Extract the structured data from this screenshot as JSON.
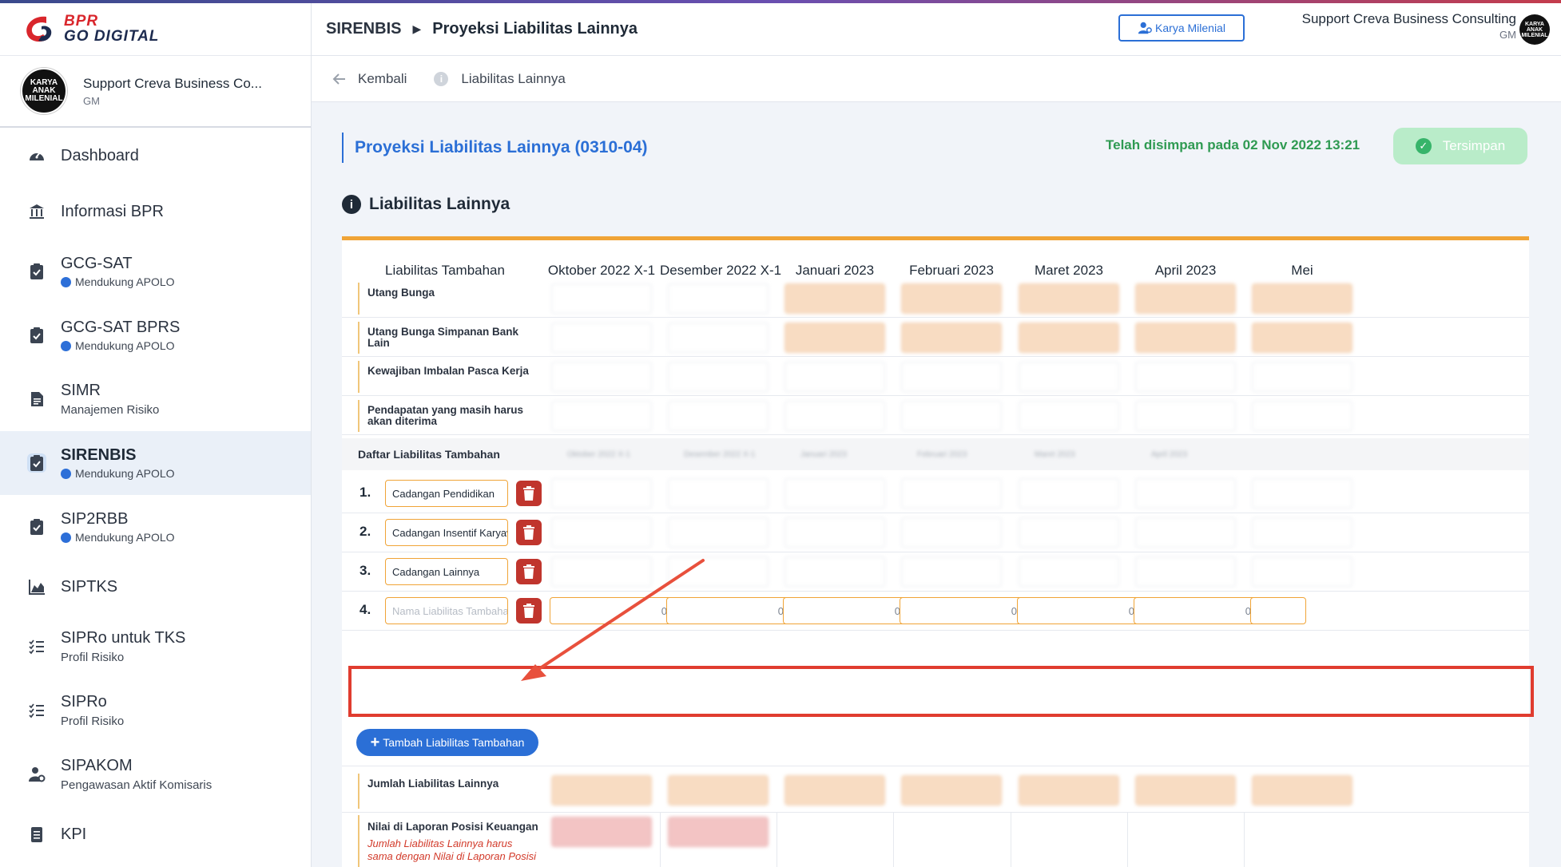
{
  "logo": {
    "line1": "BPR",
    "line2": "GO DIGITAL"
  },
  "sidebar_user": {
    "avatar_text": "KARYA ANAK MILENIAL",
    "name": "Support Creva Business Co...",
    "role": "GM"
  },
  "sidebar": {
    "items": [
      {
        "label": "Dashboard",
        "sub": "",
        "badge": "",
        "icon": "dashboard-icon"
      },
      {
        "label": "Informasi BPR",
        "sub": "",
        "badge": "",
        "icon": "bank-icon"
      },
      {
        "label": "GCG-SAT",
        "sub": "",
        "badge": "Mendukung APOLO",
        "icon": "clipboard-check-icon"
      },
      {
        "label": "GCG-SAT BPRS",
        "sub": "",
        "badge": "Mendukung APOLO",
        "icon": "clipboard-check-icon"
      },
      {
        "label": "SIMR",
        "sub": "Manajemen Risiko",
        "badge": "",
        "icon": "document-icon"
      },
      {
        "label": "SIRENBIS",
        "sub": "",
        "badge": "Mendukung APOLO",
        "icon": "clipboard-check-icon",
        "active": true
      },
      {
        "label": "SIP2RBB",
        "sub": "",
        "badge": "Mendukung APOLO",
        "icon": "clipboard-check-icon"
      },
      {
        "label": "SIPTKS",
        "sub": "",
        "badge": "",
        "icon": "area-chart-icon"
      },
      {
        "label": "SIPRo untuk TKS",
        "sub": "Profil Risiko",
        "badge": "",
        "icon": "checklist-icon"
      },
      {
        "label": "SIPRo",
        "sub": "Profil Risiko",
        "badge": "",
        "icon": "checklist-icon"
      },
      {
        "label": "SIPAKOM",
        "sub": "Pengawasan Aktif Komisaris",
        "badge": "",
        "icon": "user-gear-icon"
      },
      {
        "label": "KPI",
        "sub": "",
        "badge": "",
        "icon": "list-icon"
      }
    ]
  },
  "topbar": {
    "breadcrumb_root": "SIRENBIS",
    "breadcrumb_page": "Proyeksi Liabilitas Lainnya",
    "team_button": "Karya Milenial",
    "user_name": "Support Creva Business Consulting",
    "user_role": "GM",
    "avatar_text": "KARYA ANAK MILENIAL"
  },
  "subbar": {
    "back_label": "Kembali",
    "info_label": "Liabilitas Lainnya"
  },
  "page": {
    "title": "Proyeksi Liabilitas Lainnya (0310-04)",
    "saved_text": "Telah disimpan pada 02 Nov 2022 13:21",
    "saved_button": "Tersimpan",
    "section_title": "Liabilitas Lainnya"
  },
  "table": {
    "first_column_header": "Liabilitas Tambahan",
    "columns": [
      "Oktober 2022 X-1",
      "Desember 2022 X-1",
      "Januari 2023",
      "Februari 2023",
      "Maret 2023",
      "April 2023",
      "Mei"
    ],
    "fixed_rows": [
      {
        "label": "Utang Bunga"
      },
      {
        "label": "Utang Bunga Simpanan Bank Lain"
      },
      {
        "label": "Kewajiban Imbalan Pasca Kerja"
      },
      {
        "label": "Pendapatan yang masih harus akan diterima"
      }
    ],
    "daftar_label": "Daftar Liabilitas Tambahan",
    "additional_rows": [
      {
        "number": "1.",
        "name": "Cadangan Pendidikan",
        "placeholder": ""
      },
      {
        "number": "2.",
        "name": "Cadangan Insentif Karyawan",
        "placeholder": ""
      },
      {
        "number": "3.",
        "name": "Cadangan Lainnya",
        "placeholder": ""
      },
      {
        "number": "4.",
        "name": "",
        "placeholder": "Nama Liabilitas Tambahan",
        "values": [
          "0",
          "0",
          "0",
          "0",
          "0",
          "0",
          ""
        ]
      }
    ],
    "add_button": "Tambah Liabilitas Tambahan",
    "total_label": "Jumlah Liabilitas Lainnya",
    "neraca_label": "Nilai di Laporan Posisi Keuangan",
    "neraca_warning": "Jumlah Liabilitas Lainnya harus sama dengan Nilai di Laporan Posisi"
  },
  "colors": {
    "primary": "#2b6fd6",
    "accent": "#f0a437",
    "danger": "#c0352d",
    "success": "#2f9a52",
    "highlight": "#e03c2f"
  }
}
